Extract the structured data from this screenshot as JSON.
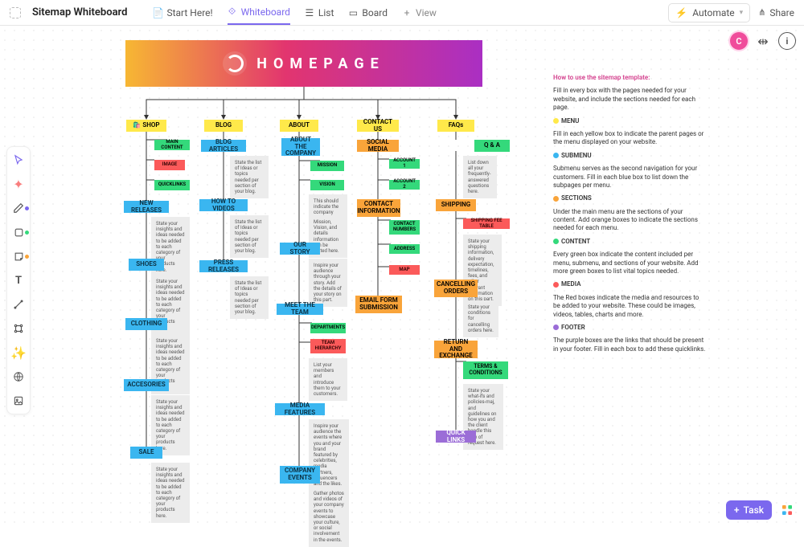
{
  "header": {
    "title": "Sitemap Whiteboard",
    "tabs": [
      {
        "label": "Start Here!",
        "icon": "doc"
      },
      {
        "label": "Whiteboard",
        "icon": "whiteboard",
        "active": true
      },
      {
        "label": "List",
        "icon": "list"
      },
      {
        "label": "Board",
        "icon": "board"
      }
    ],
    "addView": "View",
    "automate": "Automate",
    "share": "Share"
  },
  "banner": {
    "text": "HOMEPAGE"
  },
  "avatar": "C",
  "cols": {
    "shop": {
      "menu": "🛍️ SHOP",
      "sections": [
        "MAIN CONTENT",
        "IMAGE",
        "QUICKLINKS"
      ],
      "subs": [
        "NEW RELEASES",
        "SHOES",
        "CLOTHING",
        "ACCESORIES",
        "SALE"
      ],
      "note": "State your insights and ideas needed to be added to each category of your products here."
    },
    "blog": {
      "menu": "BLOG",
      "subs": [
        "BLOG ARTICLES",
        "HOW TO VIDEOS",
        "PRESS RELEASES"
      ],
      "note": "State the list of Ideas or topics needed per section of your blog."
    },
    "about": {
      "menu": "ABOUT",
      "subs": [
        "ABOUT THE COMPANY",
        "OUR STORY",
        "MEET THE TEAM",
        "MEDIA FEATURES",
        "COMPANY EVENTS"
      ],
      "company_secs": [
        "MISSION",
        "VISION"
      ],
      "company_note1": "This should indicate the company details of your brand.",
      "company_note2": "Mission, Vision, and details information can be stated here.",
      "story_note": "Inspire your audience through your story. Add the details of your story on this part.",
      "team_secs": [
        "DEPARTMENTS",
        "TEAM HIERARCHY"
      ],
      "team_note": "List your members and introduce them to your customers.",
      "media_note": "Inspire your audience the events where you and your brand featured by celebrities, media partners, influencers and the likes.",
      "events_note": "Gather photos and videos of your company events to showcase your culture, or social involvement in the events."
    },
    "contact": {
      "menu": "CONTACT US",
      "subs": [
        "SOCIAL MEDIA",
        "CONTACT INFORMATION",
        "EMAIL FORM SUBMISSION"
      ],
      "social": [
        "ACCOUNT 1",
        "ACCOUNT 2"
      ],
      "info": [
        "CONTACT NUMBERS",
        "ADDRESS",
        "MAP"
      ]
    },
    "faqs": {
      "menu": "FAQs",
      "subs": [
        "Q & A",
        "SHIPPING",
        "CANCELLING ORDERS",
        "RETURN AND EXCHANGE",
        "QUICK LINKS"
      ],
      "qa_note": "List down all your frequently-answered questions here.",
      "shipping_red": "SHIPPING FEE TABLE",
      "shipping_note": "State your shipping information, delivery expectation, timelines, fees, and other relevant information on this part.",
      "cancel_note": "State your conditions for cancelling orders here.",
      "terms": "TERMS & CONDITIONS",
      "terms_note": "State your what-ifs and policies-maj, and guidelines on how you and the client handle this type of request here."
    }
  },
  "legend": {
    "title": "How to use the sitemap template:",
    "intro": "Fill in every box with the pages needed for your website, and include the sections needed for each page.",
    "items": [
      {
        "dot": "#ffe94a",
        "head": "MENU",
        "body": "Fill in each yellow box to indicate the parent pages or the menu displayed on your website."
      },
      {
        "dot": "#3ab6f0",
        "head": "SUBMENU",
        "body": "Submenu serves as the second navigation for your customers. Fill in each blue box to list down the subpages per menu."
      },
      {
        "dot": "#f9a43a",
        "head": "SECTIONS",
        "body": "Under the main menu are the sections of your content. Add orange boxes to indicate the sections needed for each menu."
      },
      {
        "dot": "#34d97b",
        "head": "CONTENT",
        "body": "Every green box indicate the content included per menu, submenu, and sections of your website. Add more green boxes to list vital topics needed."
      },
      {
        "dot": "#fb5a5a",
        "head": "MEDIA",
        "body": "The Red boxes indicate the media and resources to be added to your website. These could be images, videos, tables, charts and more."
      },
      {
        "dot": "#9b6dd7",
        "head": "FOOTER",
        "body": "The purple boxes are the links that should be present in your footer. Fill in each box to add these quicklinks."
      }
    ]
  },
  "taskBtn": "Task"
}
